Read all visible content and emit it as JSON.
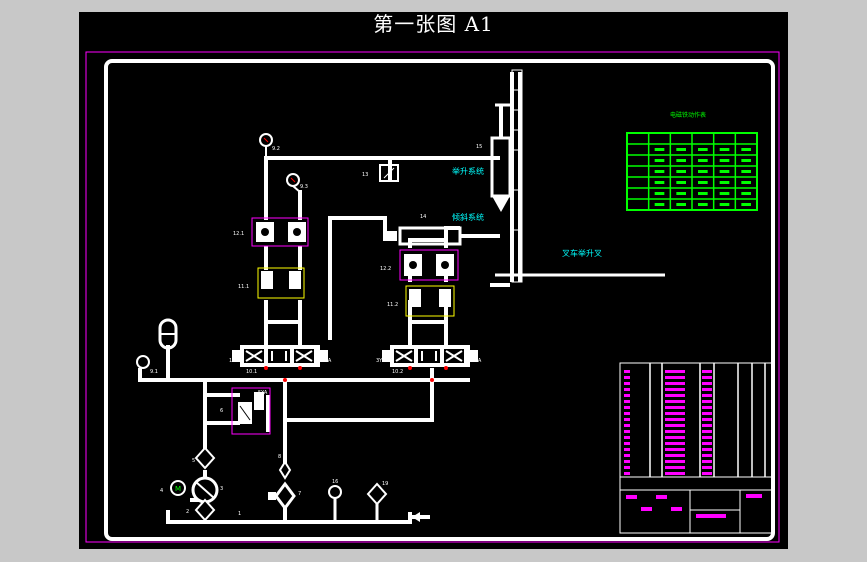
{
  "title": "第一张图 A1",
  "labels": {
    "lift_cylinder": "举升系统",
    "tilt_cylinder": "倾斜系统",
    "fork_lift": "叉车举升叉",
    "solenoid_table_title": "电磁铁动作表"
  },
  "component_numbers": {
    "c1": "1",
    "c2": "2",
    "c3": "3",
    "c4": "4",
    "c5": "5",
    "c6": "6",
    "c7": "7",
    "c8": "8",
    "c9_1": "9.1",
    "c10_1": "10.1",
    "c10_2": "10.2",
    "c11_1": "11.1",
    "c11_2": "11.2",
    "c12_1": "12.1",
    "c12_2": "12.2",
    "c13": "13",
    "c14": "14",
    "c15": "15",
    "c16": "16",
    "c19": "19",
    "g9_2": "9.2",
    "g9_3": "9.3"
  },
  "valve_ports": {
    "v1_left": "1YA",
    "v1_right": "2YA",
    "v2_left": "3YA",
    "v2_right": "4YA",
    "v3": "5YA"
  },
  "colors": {
    "background": "#000000",
    "frame": "#ffffff",
    "border": "#ff00ff",
    "table": "#00ff00",
    "annotation": "#00ffff",
    "marker": "#ff0000",
    "yellow": "#ffff00"
  }
}
